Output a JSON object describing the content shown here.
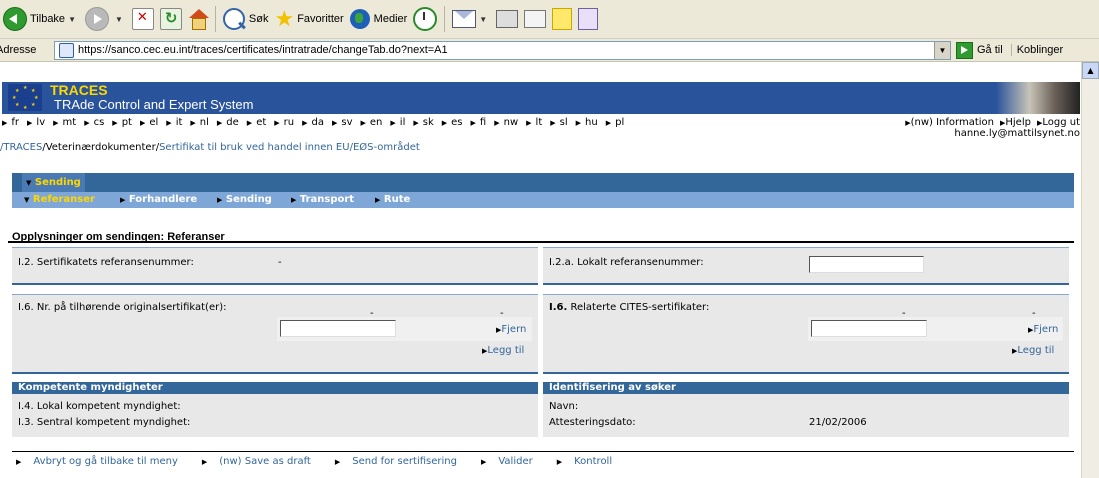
{
  "browser": {
    "back_label": "Tilbake",
    "search_label": "Søk",
    "favorites_label": "Favoritter",
    "media_label": "Medier",
    "address_label": "Adresse",
    "url": "https://sanco.cec.eu.int/traces/certificates/intratrade/changeTab.do?next=A1",
    "go_label": "Gå til",
    "links_label": "Koblinger"
  },
  "app": {
    "title": "TRACES",
    "subtitle": "TRAde Control and Expert System",
    "languages": [
      "fr",
      "lv",
      "mt",
      "cs",
      "pt",
      "el",
      "it",
      "nl",
      "de",
      "et",
      "ru",
      "da",
      "sv",
      "en",
      "il",
      "sk",
      "es",
      "fi",
      "nw",
      "lt",
      "sl",
      "hu",
      "pl"
    ],
    "top_links": [
      "(nw) Information",
      "Hjelp",
      "Logg ut"
    ],
    "user": "hanne.ly@mattilsynet.no"
  },
  "breadcrumb": {
    "root": "/TRACES",
    "level1": "Veterinærdokumenter",
    "sep": "/",
    "level2": "Sertifikat til bruk ved handel innen EU/EØS-området"
  },
  "tabs": {
    "main": "Sending",
    "sub": [
      "Referanser",
      "Forhandlere",
      "Sending",
      "Transport",
      "Rute"
    ]
  },
  "form": {
    "section_title": "Opplysninger om sendingen: Referanser",
    "i2_label": "I.2. Sertifikatets referansenummer:",
    "i2_value": "-",
    "i2a_label": "I.2.a. Lokalt referansenummer:",
    "i2a_value": "",
    "i6_label": "I.6. Nr. på tilhørende originalsertifikat(er):",
    "i6_dash1": "-",
    "i6_dash2": "-",
    "i6_value": "",
    "remove_label": "Fjern",
    "add_label": "Legg til",
    "i6b_prefix": "I.6.",
    "i6b_label": " Relaterte CITES-sertifikater:",
    "i6b_dash1": "-",
    "i6b_dash2": "-",
    "i6b_value": "",
    "authorities_title": "Kompetente myndigheter",
    "i4_label": "I.4. Lokal kompetent myndighet:",
    "i3_label": "I.3. Sentral kompetent myndighet:",
    "applicant_title": "Identifisering av søker",
    "name_label": "Navn:",
    "attest_label": "Attesteringsdato:",
    "attest_value": "21/02/2006"
  },
  "actions": [
    "Avbryt og gå tilbake til meny",
    "(nw) Save as draft",
    "Send for sertifisering",
    "Valider",
    "Kontroll"
  ]
}
